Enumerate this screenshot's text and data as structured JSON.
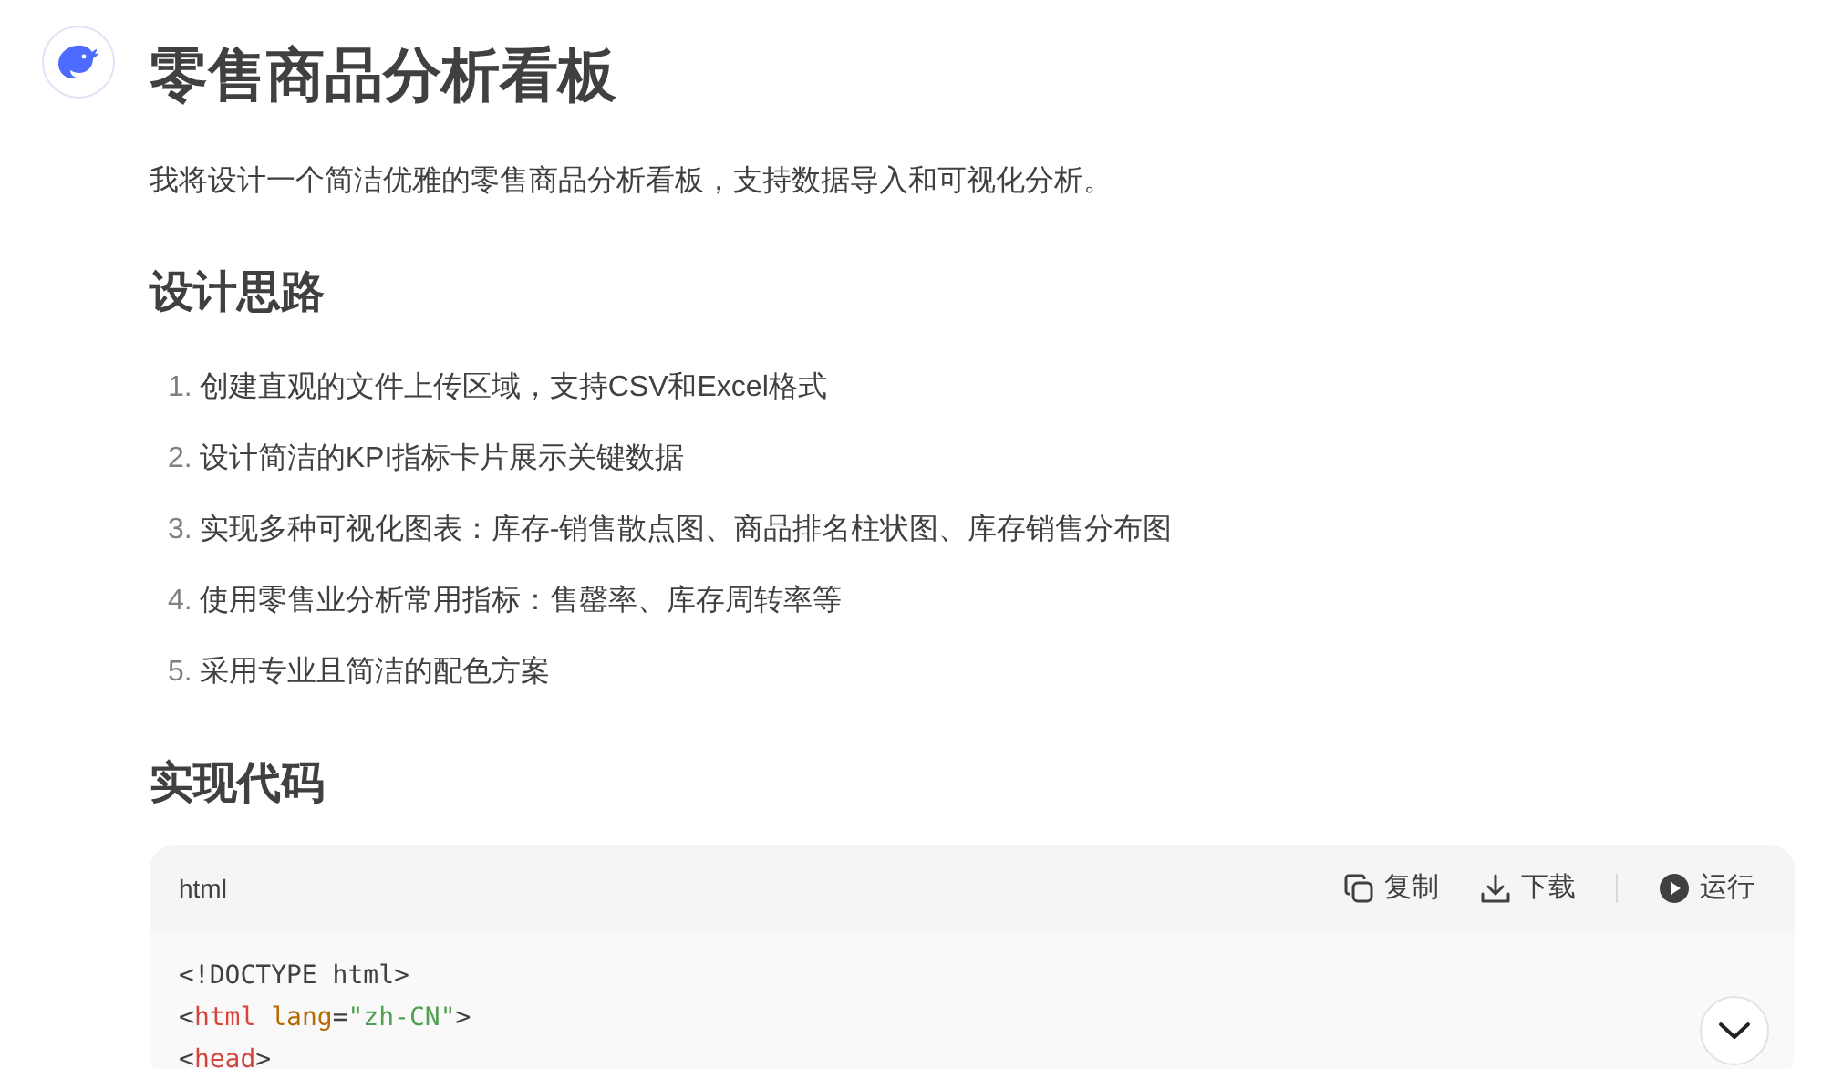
{
  "title": "零售商品分析看板",
  "intro": "我将设计一个简洁优雅的零售商品分析看板，支持数据导入和可视化分析。",
  "sections": [
    {
      "heading": "设计思路",
      "items": [
        {
          "number": "1.",
          "text": "创建直观的文件上传区域，支持CSV和Excel格式"
        },
        {
          "number": "2.",
          "text": "设计简洁的KPI指标卡片展示关键数据"
        },
        {
          "number": "3.",
          "text": "实现多种可视化图表：库存-销售散点图、商品排名柱状图、库存销售分布图"
        },
        {
          "number": "4.",
          "text": "使用零售业分析常用指标：售罄率、库存周转率等"
        },
        {
          "number": "5.",
          "text": "采用专业且简洁的配色方案"
        }
      ]
    },
    {
      "heading": "实现代码"
    }
  ],
  "code_block": {
    "language": "html",
    "actions": [
      {
        "kind": "copy",
        "label": "复制"
      },
      {
        "kind": "download",
        "label": "下载"
      },
      {
        "kind": "run",
        "label": "运行"
      }
    ],
    "lines": [
      [
        {
          "kind": "plain",
          "text": "<!DOCTYPE html>"
        }
      ],
      [
        {
          "kind": "plain",
          "text": "<"
        },
        {
          "kind": "tag",
          "text": "html "
        },
        {
          "kind": "attr",
          "text": "lang"
        },
        {
          "kind": "plain",
          "text": "="
        },
        {
          "kind": "string",
          "text": "\"zh-CN\""
        },
        {
          "kind": "plain",
          "text": ">"
        }
      ],
      [
        {
          "kind": "plain",
          "text": "<"
        },
        {
          "kind": "tag",
          "text": "head"
        },
        {
          "kind": "plain",
          "text": ">"
        }
      ]
    ]
  }
}
